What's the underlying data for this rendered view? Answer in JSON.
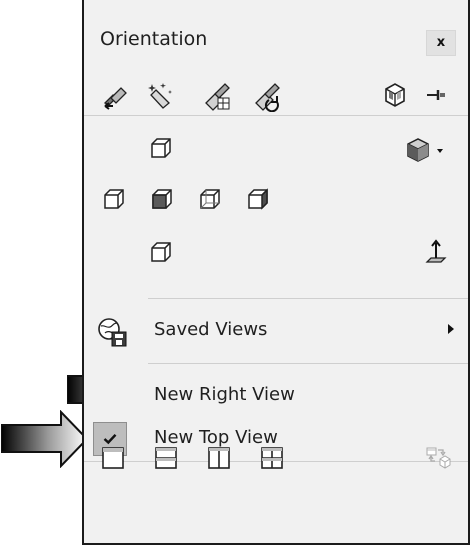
{
  "panel": {
    "title": "Orientation",
    "close_label": "x"
  },
  "toolbar": {
    "icons": [
      "previous-view-icon",
      "new-view-icon",
      "update-standard-views-icon",
      "reset-standard-views-icon",
      "view-selector-icon",
      "pin-icon"
    ]
  },
  "views": {
    "icons": [
      "top-view-icon",
      "front-view-icon",
      "left-view-icon",
      "back-view-icon",
      "right-view-icon",
      "bottom-view-icon",
      "isometric-dropdown-icon",
      "normal-to-icon"
    ]
  },
  "menu": {
    "saved_views": "Saved Views",
    "new_right_view": "New Right View",
    "new_top_view": "New Top View"
  },
  "bottom_bar": {
    "icons": [
      "single-view-icon",
      "two-view-horizontal-icon",
      "two-view-vertical-icon",
      "four-view-icon",
      "link-views-icon"
    ]
  },
  "annotations": [
    "callout-arrow-right-view",
    "callout-arrow-top-view"
  ]
}
